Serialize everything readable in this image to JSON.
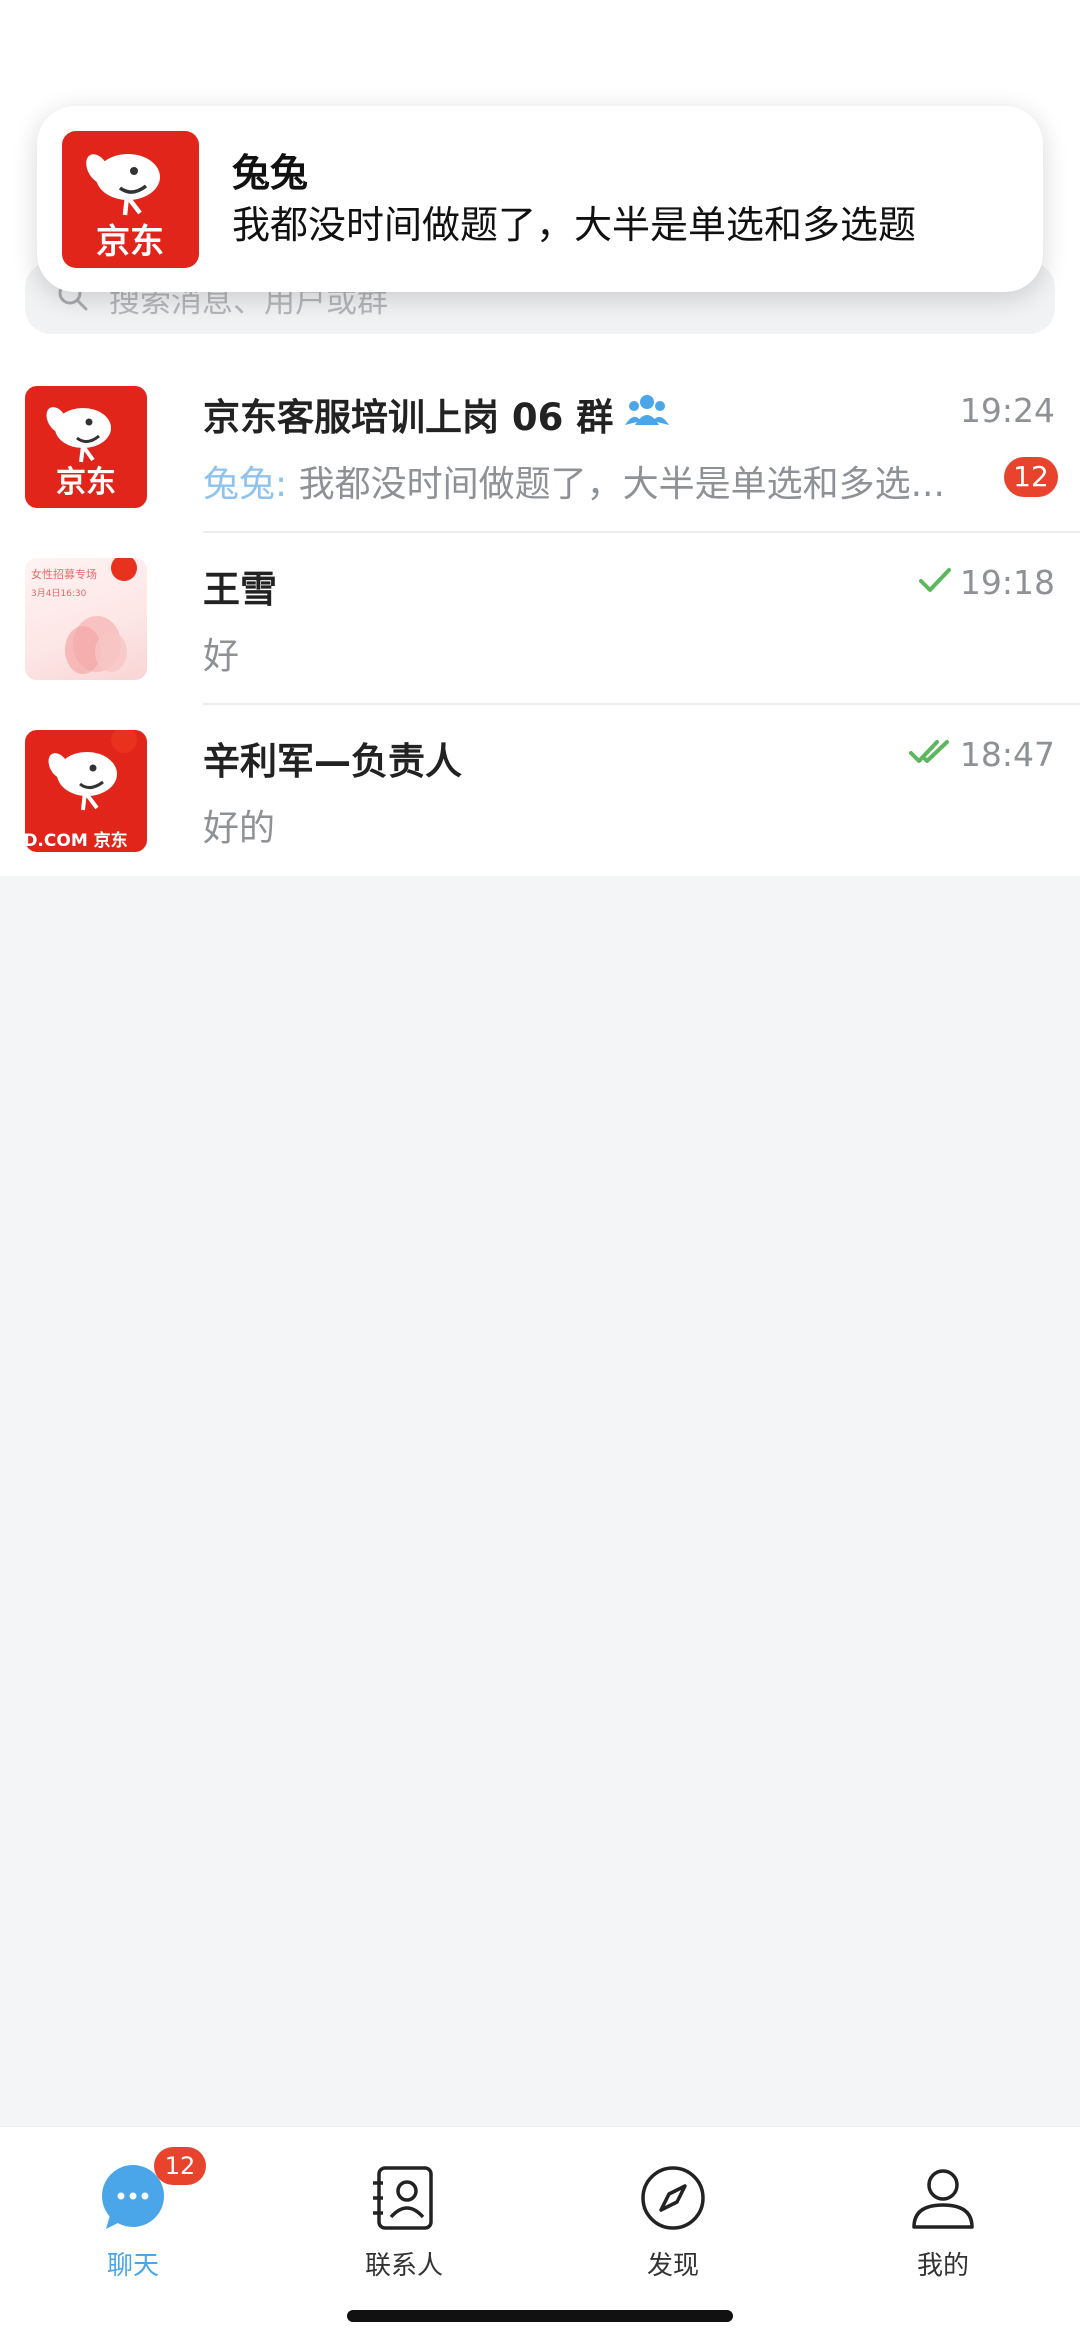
{
  "notification": {
    "sender": "兔兔",
    "message": "我都没时间做题了，大半是单选和多选题"
  },
  "search": {
    "placeholder": "搜索消息、用户或群"
  },
  "chats": [
    {
      "name": "京东客服培训上岗 06 群",
      "time": "19:24",
      "preview_sender": "兔兔:",
      "preview_text": "我都没时间做题了，大半是单选和多选...",
      "unread": "12",
      "is_group": true
    },
    {
      "name": "王雪",
      "time": "19:18",
      "preview_text": "好",
      "status": "sent",
      "avatar_text_1": "女性招募专场",
      "avatar_text_2": "3月4日16:30"
    },
    {
      "name": "辛利军—负责人",
      "time": "18:47",
      "preview_text": "好的",
      "status": "read",
      "avatar_text": "JD.COM 京东"
    }
  ],
  "tabs": [
    {
      "label": "聊天",
      "badge": "12",
      "active": true
    },
    {
      "label": "联系人"
    },
    {
      "label": "发现"
    },
    {
      "label": "我的"
    }
  ],
  "colors": {
    "brand_red": "#e1251b",
    "accent_blue": "#4aa6e8",
    "badge_red": "#e8432d",
    "check_green": "#5cb85c"
  }
}
